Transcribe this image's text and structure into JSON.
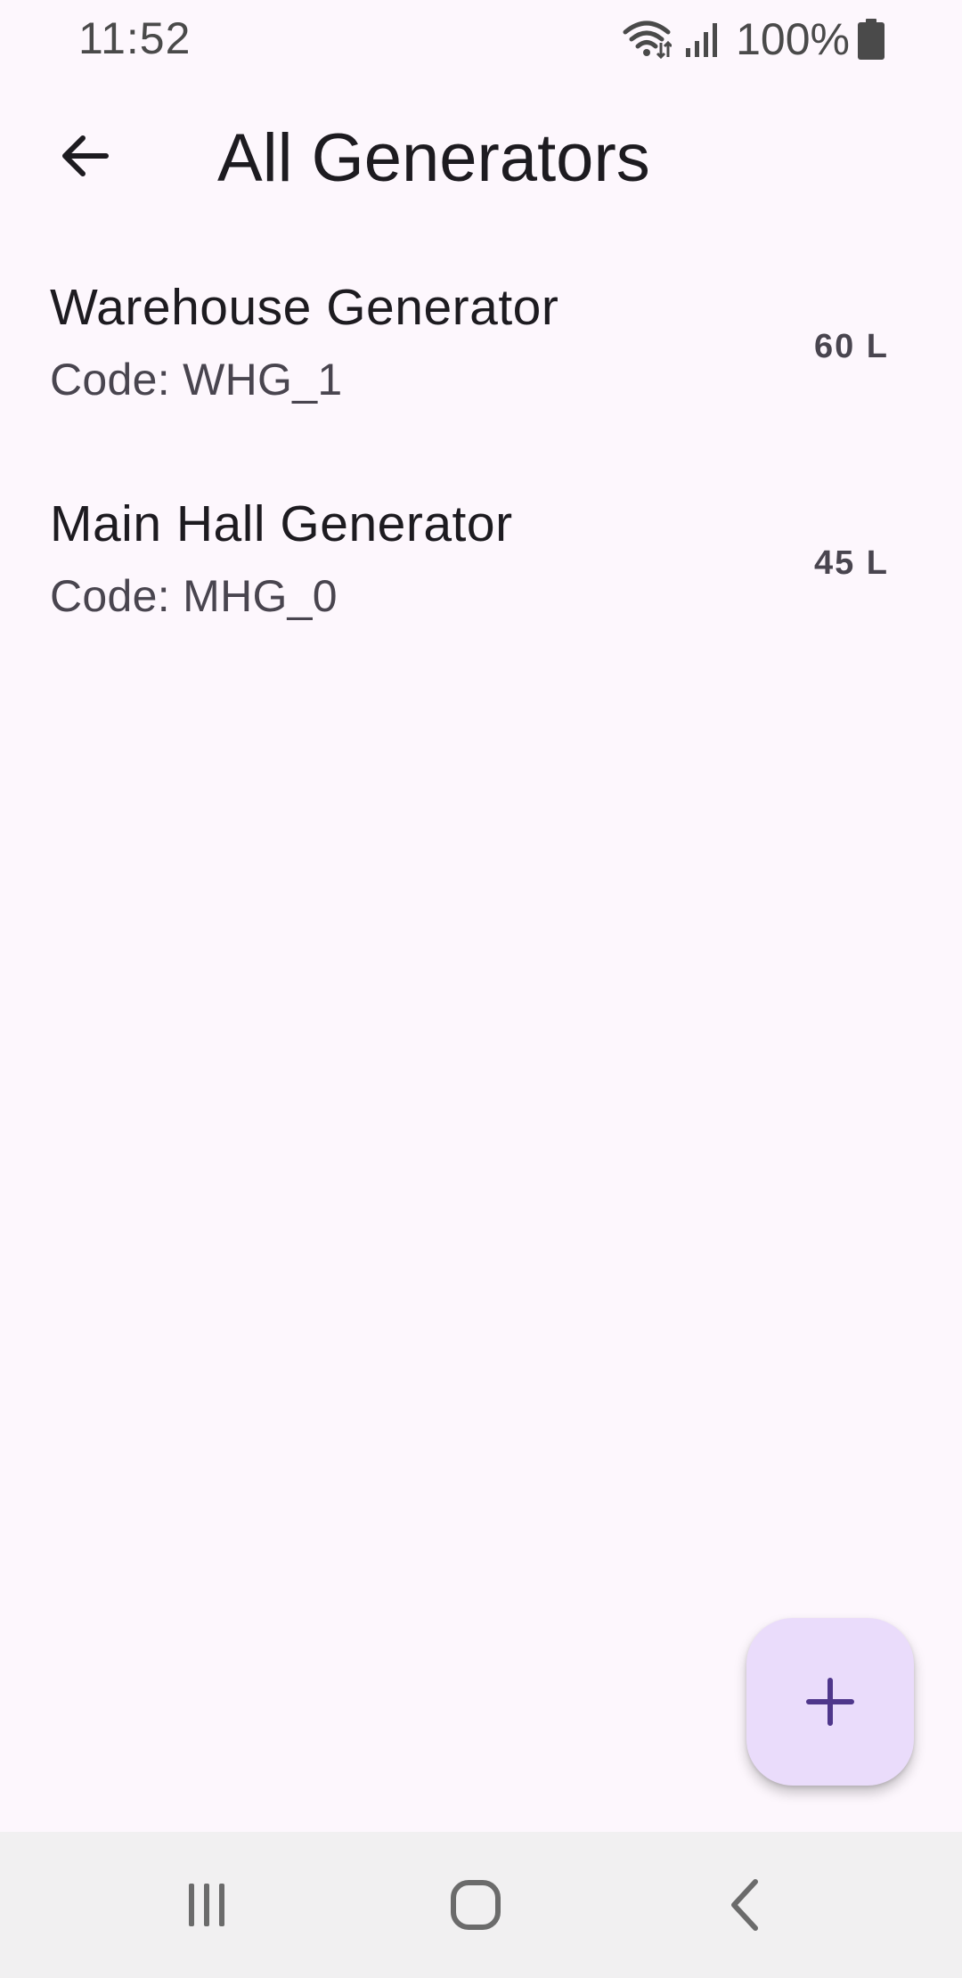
{
  "status_bar": {
    "time": "11:52",
    "battery": "100%",
    "icons": [
      "wifi-icon",
      "signal-icon",
      "battery-icon"
    ]
  },
  "app_bar": {
    "title": "All Generators",
    "back_icon": "arrow-back-icon"
  },
  "generators": [
    {
      "name": "Warehouse Generator",
      "code": "Code: WHG_1",
      "amount": "60 L"
    },
    {
      "name": "Main Hall Generator",
      "code": "Code: MHG_0",
      "amount": "45 L"
    }
  ],
  "fab": {
    "icon": "plus-icon"
  },
  "nav_bar": {
    "icons": [
      "recents-icon",
      "home-icon",
      "back-icon"
    ]
  },
  "colors": {
    "background": "#fdf7fd",
    "fab_background": "#eadcfb",
    "accent": "#4f378b",
    "nav_bar": "#f1f0f1"
  }
}
